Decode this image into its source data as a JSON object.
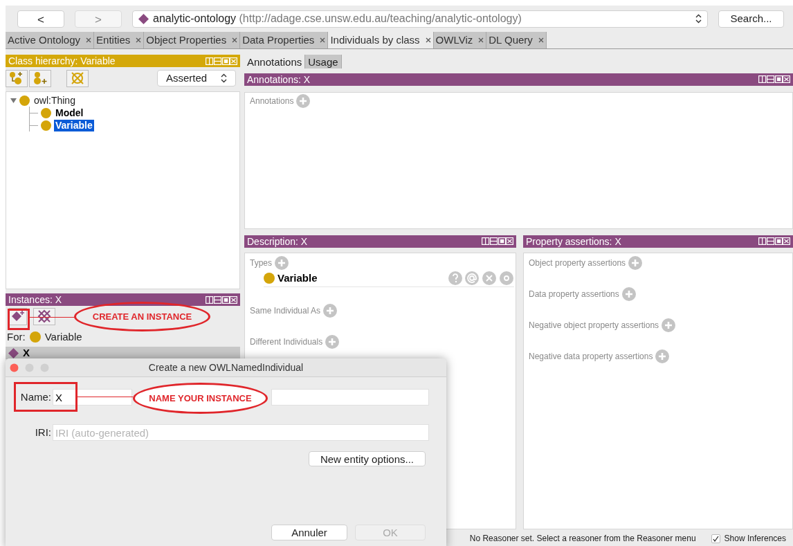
{
  "toolbar": {
    "back": "<",
    "forward": ">",
    "ontology_name": "analytic-ontology",
    "ontology_iri": "(http://adage.cse.unsw.edu.au/teaching/analytic-ontology)",
    "search": "Search..."
  },
  "tabs": [
    {
      "label": "Active Ontology",
      "selected": false
    },
    {
      "label": "Entities",
      "selected": false
    },
    {
      "label": "Object Properties",
      "selected": false
    },
    {
      "label": "Data Properties",
      "selected": false
    },
    {
      "label": "Individuals by class",
      "selected": true
    },
    {
      "label": "OWLViz",
      "selected": false
    },
    {
      "label": "DL Query",
      "selected": false
    }
  ],
  "class_hierarchy": {
    "title": "Class hierarchy: Variable",
    "mode": "Asserted",
    "tree": [
      {
        "label": "owl:Thing",
        "expanded": true,
        "selected": false,
        "children": [
          {
            "label": "Model",
            "selected": false
          },
          {
            "label": "Variable",
            "selected": true
          }
        ]
      }
    ]
  },
  "instances": {
    "title": "Instances: X",
    "callout": "CREATE AN INSTANCE",
    "for_label": "For:",
    "for_class": "Variable",
    "items": [
      {
        "label": "X",
        "selected": true
      }
    ]
  },
  "entity_tabs": [
    {
      "label": "Annotations",
      "selected": true
    },
    {
      "label": "Usage",
      "selected": false
    }
  ],
  "annotations_panel": {
    "title": "Annotations: X",
    "sections": [
      {
        "label": "Annotations"
      }
    ]
  },
  "description": {
    "title": "Description: X",
    "sections": [
      {
        "label": "Types",
        "items": [
          {
            "label": "Variable"
          }
        ]
      },
      {
        "label": "Same Individual As"
      },
      {
        "label": "Different Individuals"
      }
    ]
  },
  "property_assertions": {
    "title": "Property assertions: X",
    "sections": [
      {
        "label": "Object property assertions"
      },
      {
        "label": "Data property assertions"
      },
      {
        "label": "Negative object property assertions"
      },
      {
        "label": "Negative data property assertions"
      }
    ]
  },
  "status_bar": {
    "message": "No Reasoner set. Select a reasoner from the Reasoner menu",
    "show_inferences": {
      "label": "Show Inferences",
      "checked": true
    }
  },
  "dialog": {
    "title": "Create a new OWLNamedIndividual",
    "name_label": "Name:",
    "name_value": "X",
    "callout": "NAME YOUR INSTANCE",
    "iri_label": "IRI:",
    "iri_placeholder": "IRI (auto-generated)",
    "options_button": "New entity options...",
    "buttons": [
      {
        "label": "Annuler",
        "disabled": false
      },
      {
        "label": "OK",
        "disabled": true
      }
    ]
  }
}
